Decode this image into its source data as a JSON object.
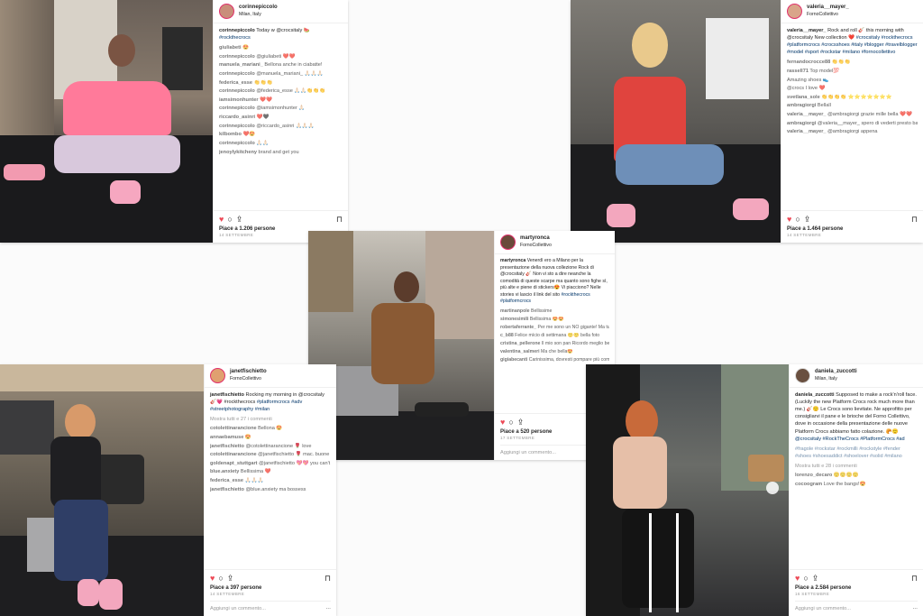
{
  "posts": [
    {
      "user": "corinnepiccolo",
      "location": "Milan, Italy",
      "caption_user": "corinnepiccolo",
      "caption_text": "Today w @crocsitaly 🍉",
      "caption_tags": "#rockthecrocs",
      "comments": [
        {
          "u": "giuliabeti",
          "t": "😍"
        },
        {
          "u": "corinnepiccolo",
          "t": "@giuliabeti ❤️❤️"
        },
        {
          "u": "manuela_mariani_",
          "t": "Bellona anche in ciabatte!"
        },
        {
          "u": "corinnepiccolo",
          "t": "@manuela_mariani_ 🙏🏻🙏🏻🙏🏻"
        },
        {
          "u": "federica_esse",
          "t": "👏👏👏"
        },
        {
          "u": "corinnepiccolo",
          "t": "@federica_esse 🙏🏻🙏🏻👏👏👏"
        },
        {
          "u": "iamsimonhunter",
          "t": "❤️❤️"
        },
        {
          "u": "corinnepiccolo",
          "t": "@iamsimonhunter 🙏🏻"
        },
        {
          "u": "riccardo_asinri",
          "t": "❤️🖤"
        },
        {
          "u": "corinnepiccolo",
          "t": "@riccardo_asinri 🙏🏻🙏🏻🙏🏻"
        },
        {
          "u": "kilbombo",
          "t": "❤️😍"
        },
        {
          "u": "corinnepiccolo",
          "t": "🙏🏻🙏🏻"
        },
        {
          "u": "jenoylykitcheny",
          "t": "brand and get you"
        }
      ],
      "likes": "Piace a 1.206 persone",
      "date": "14 SETTEMBRE"
    },
    {
      "user": "valeria__mayer_",
      "location": "FornoCollettivo",
      "caption_user": "valeria__mayer_",
      "caption_text": "Rock and roll 🎸 this morning with @crocsitaly New collection ❤️",
      "caption_tags": "#crocsitaly #rockthecrocs #platformcrocs #crocsshoes #italy #blogger #travelblogger #model #sport #rockstar #milano #fornocollettivo",
      "comments": [
        {
          "u": "fernandocrocce88",
          "t": "👏👏👏"
        },
        {
          "u": "rassell71",
          "t": "Top model💯"
        },
        {
          "u": "",
          "t": "Amazing shoes 👟"
        },
        {
          "u": "",
          "t": "@crocs I love ❤️"
        },
        {
          "u": "svetlana_sole",
          "t": "👏👏👏👏 ⭐⭐⭐⭐⭐⭐⭐"
        },
        {
          "u": "ambragiorgi",
          "t": "Bellall"
        },
        {
          "u": "valeria__mayer_",
          "t": "@ambragiorgi grazie mille bella ❤️❤️"
        },
        {
          "u": "ambragiorgi",
          "t": "@valeria__mayer_ spero di vederti presto baby"
        },
        {
          "u": "valeria__mayer_",
          "t": "@ambragiorgi appena"
        }
      ],
      "likes": "Piace a 1.464 persone",
      "date": "14 SETTEMBRE"
    },
    {
      "user": "martyronca",
      "location": "FornoCollettivo",
      "caption_user": "martyronca",
      "caption_text": "Venerdì ero a Milano per la presentazione della nuova collezione Rock di @crocsitaly 🎸 Non vi sto a dire neanche la comodità di queste scarpe ma quanto sono fighe sì, più alte e piene di stickers😍 Vi piacciono? Nelle stories vi lascio il link del sito",
      "caption_tags": "#rockthecrocs #platformcrocs",
      "comments": [
        {
          "u": "martinanpole",
          "t": "Bellissime"
        },
        {
          "u": "simonesimili",
          "t": "Bellissima 😍😍"
        },
        {
          "u": "robertaferrante_",
          "t": "Per me sono un NO gigante! Ma tu sei stupenda !"
        },
        {
          "u": "c_b88",
          "t": "Felice mìcio di settimana 🙂🙂 bella foto"
        },
        {
          "u": "cristina_pellerone",
          "t": "Il mio son pan Ricordo meglio bene😍🙂"
        },
        {
          "u": "valentina_salmeri",
          "t": "Ma che bella😍"
        },
        {
          "u": "gigiabecanti",
          "t": "Carinissima, dovresti pompare più complimenti 😍🖤"
        }
      ],
      "likes": "Piace a 520 persone",
      "date": "17 SETTEMBRE",
      "add_comment": "Aggiungi un commento...",
      "more": "···"
    },
    {
      "user": "janetfischietto",
      "location": "FornoCollettivo",
      "caption_user": "janetfischietto",
      "caption_text": "Rocking my morning in @crocsitaly 🎸💗 #rockthecrocs",
      "caption_tags": "#platformcrocs #adv #streetphotography #milan",
      "show_all": "Mostra tutti e 27 i commenti",
      "comments": [
        {
          "u": "cotolettinarancione",
          "t": "Bellona 😍"
        },
        {
          "u": "annaebamuse",
          "t": "😍"
        },
        {
          "u": "janetfischietto",
          "t": "@cotolettinarancione 🌹 love"
        },
        {
          "u": "cotolettinarancione",
          "t": "@janetfischietto 🌹 mac. buone giornata baby"
        },
        {
          "u": "goldenapt_stuttgart",
          "t": "@janetfischietto 💖💖 you can't wait to see you!"
        },
        {
          "u": "blue.anxiety",
          "t": "Bellissima ❤️"
        },
        {
          "u": "federica_esse",
          "t": "🙏🏻🙏🏻🙏🏻"
        },
        {
          "u": "janetfischietto",
          "t": "@blue.anxiety ma bossess"
        }
      ],
      "likes": "Piace a 397 persone",
      "date": "14 SETTEMBRE",
      "add_comment": "Aggiungi un commento...",
      "more": "···"
    },
    {
      "user": "daniela_zuccotti",
      "location": "Milan, Italy",
      "caption_user": "daniela_zuccotti",
      "caption_text": "Supposed to make a rock'n'roll face. (Luckily the new Platform Crocs rock much more than me.) 🎸🙂 Le Crocs sono lievitate. Ne approfitto per consigliarvi il pane e le brioche del Forno Collettivo, dove in occasione della presentazione delle nuove Platform Crocs abbiamo fatto colazione. 🥐🙂",
      "caption_tags": "@crocsitaly #RockTheCrocs #PlatformCrocs #ad",
      "hashtags2": "#fragole #rockstar #rockmilli #rockstyle #fender #shoes #shoesaddict #shoelover #solid #milano",
      "show_all": "Mostra tutti e 28 i commenti",
      "comments": [
        {
          "u": "lorenzo_decaro",
          "t": "🙂🙂🙂🙂"
        },
        {
          "u": "cocoogram",
          "t": "Love the bangs!😍"
        }
      ],
      "likes": "Piace a 2.584 persone",
      "date": "16 SETTEMBRE",
      "add_comment": "Aggiungi un commento...",
      "more": "···"
    }
  ],
  "icons": {
    "like": "heart-icon",
    "comment": "comment-icon",
    "share": "share-icon",
    "save": "bookmark-icon"
  },
  "colors": {
    "like_red": "#ed4956",
    "link_blue": "#003569",
    "border": "#efefef"
  }
}
